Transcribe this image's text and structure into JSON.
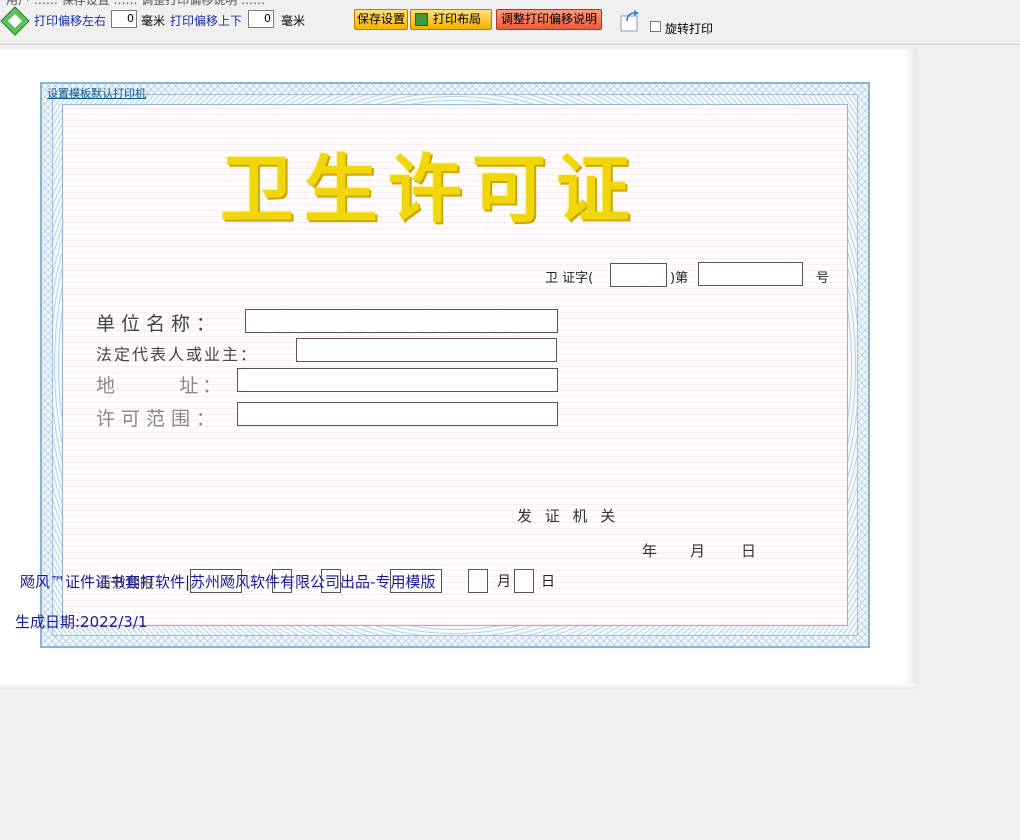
{
  "toolbar": {
    "offset_lr_label": "打印偏移左右",
    "offset_lr_value": "0",
    "offset_ud_label": "打印偏移上下",
    "offset_ud_value": "0",
    "unit_mm": "毫米",
    "save_label": "保存设置",
    "layout_label": "打印布局",
    "explain_label": "调整打印偏移说明",
    "rotate_label": "旋转打印",
    "rotate_checked": false
  },
  "certificate": {
    "set_default_printer": "设置模板默认打印机",
    "title": "卫生许可证",
    "number_prefix": "卫  证字(",
    "number_mid": ")第",
    "number_suffix": "号",
    "unit_name_label": "单位名称：",
    "legal_rep_label": "法定代表人或业主：",
    "address_label": "地      址：",
    "scope_label": "许可范围：",
    "issuing_authority": "发 证 机 关",
    "date_year": "年",
    "date_month": "月",
    "date_day": "日",
    "validity_label": "有效期限",
    "overlay_month": "月",
    "overlay_day": "日"
  },
  "footer": {
    "brand_text": "飏风™证件证书套打软件|苏州飏风软件有限公司出品-专用模版",
    "generated_date": "生成日期:2022/3/1"
  },
  "colors": {
    "title_gold": "#f2d60c",
    "link_blue": "#1a2fa8",
    "brand_blue": "#1a1a9a"
  }
}
